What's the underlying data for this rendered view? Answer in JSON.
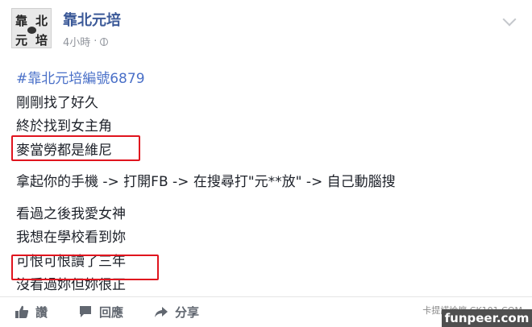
{
  "post": {
    "author": "靠北元培",
    "time": "4小時",
    "separator": "·",
    "avatar_chars": [
      "靠",
      "北",
      "元",
      "培"
    ],
    "hashtag": "#靠北元培編號6879",
    "lines_block1": [
      "剛剛找了好久",
      "終於找到女主角",
      "麥當勞都是維尼"
    ],
    "line_block2": "拿起你的手機 -> 打開FB -> 在搜尋打\"元**放\" -> 自己動腦搜",
    "lines_block3": [
      "看過之後我愛女神",
      "我想在學校看到妳",
      "可恨可恨讀了三年",
      "沒看過妳但妳很正"
    ]
  },
  "actions": {
    "like": "讚",
    "comment": "回應",
    "share": "分享"
  },
  "watermark": {
    "line": "卡提諾論壇 CK101.COM",
    "site": "funpeer.com"
  },
  "colors": {
    "author": "#3b5998",
    "hashtag": "#4a70c8",
    "highlight_box": "#e0141e"
  }
}
